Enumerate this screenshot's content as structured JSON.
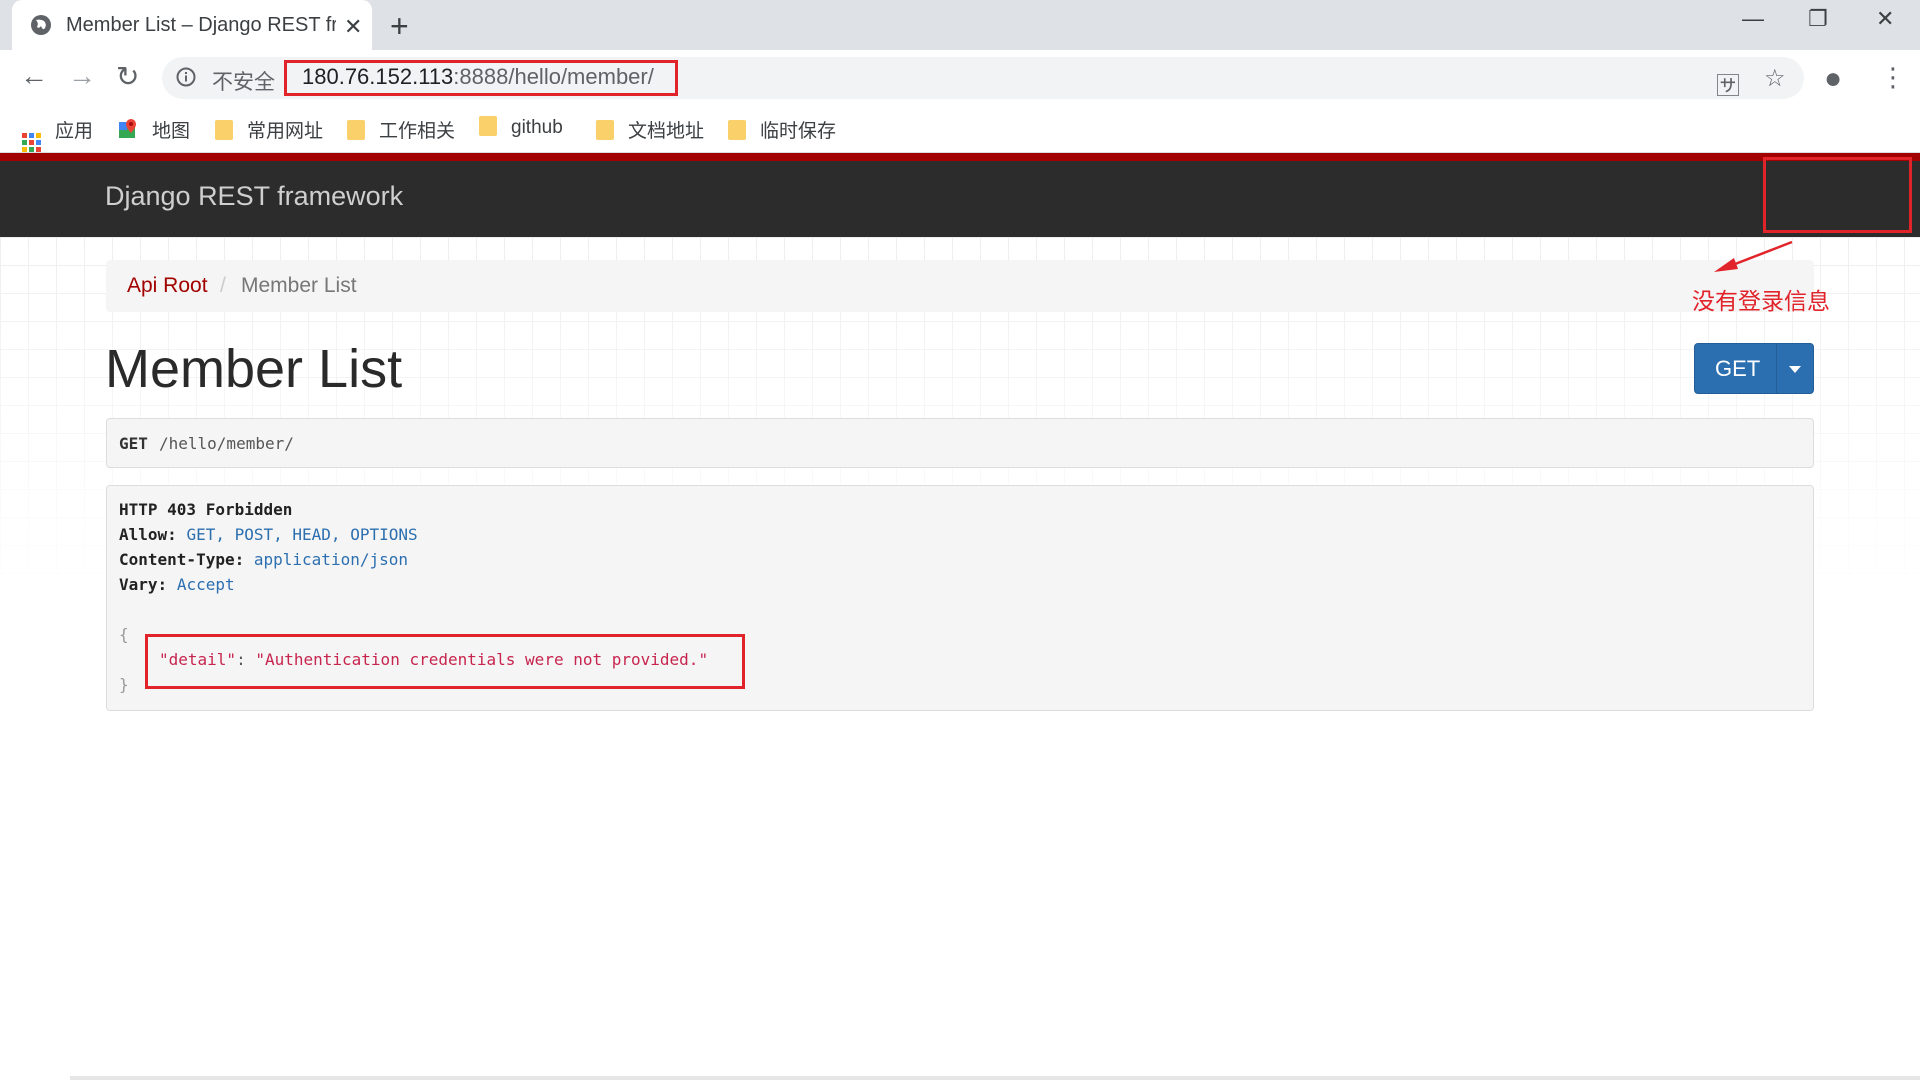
{
  "browser": {
    "tab_title": "Member List – Django REST framework",
    "security_label": "不安全",
    "url_host": "180.76.152.113",
    "url_rest": ":8888/hello/member/",
    "bookmarks": [
      {
        "label": "应用"
      },
      {
        "label": "地图"
      },
      {
        "label": "常用网址"
      },
      {
        "label": "工作相关"
      },
      {
        "label": "github"
      },
      {
        "label": "文档地址"
      },
      {
        "label": "临时保存"
      }
    ]
  },
  "page": {
    "brand": "Django REST framework",
    "breadcrumb": [
      "Api Root",
      "/",
      "Member List"
    ],
    "title": "Member List",
    "get_button": "GET",
    "request": {
      "method": "GET",
      "path": "/hello/member/"
    },
    "response": {
      "status": "HTTP 403 Forbidden",
      "headers": [
        {
          "name": "Allow:",
          "value": "GET, POST, HEAD, OPTIONS"
        },
        {
          "name": "Content-Type:",
          "value": "application/json"
        },
        {
          "name": "Vary:",
          "value": "Accept"
        }
      ],
      "open_brace": "{",
      "close_brace": "}",
      "detail_key": "\"detail\"",
      "colon": ": ",
      "detail_value": "\"Authentication credentials were not provided.\""
    }
  },
  "annotation": {
    "note": "没有登录信息",
    "color": "#e1232a"
  },
  "colors": {
    "accent_red": "#a30000",
    "navbar": "#2c2c2c",
    "button_blue": "#2c6fb0"
  }
}
